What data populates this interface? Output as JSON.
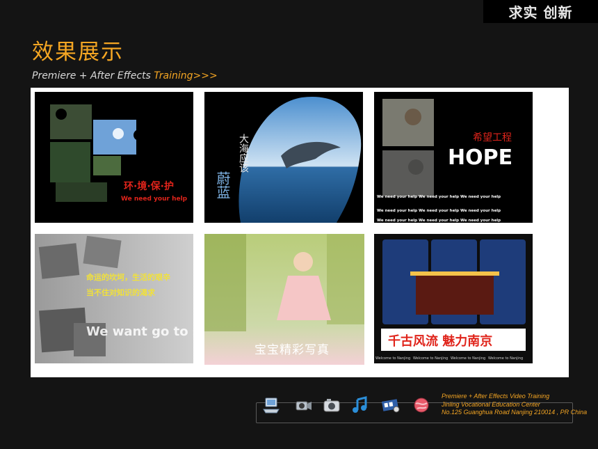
{
  "header": {
    "motto": "求实 创新",
    "title": "效果展示",
    "subtitle_prefix": "Premiere + After Effects ",
    "subtitle_highlight": "Training>>>"
  },
  "gallery": [
    {
      "id": "environment",
      "caption_cn": "环·境·保·护",
      "caption_en": "We need your help"
    },
    {
      "id": "dolphin",
      "caption_cn": "大海应该",
      "caption_cn2": "蔚蓝"
    },
    {
      "id": "hope",
      "caption_cn": "希望工程",
      "caption_en": "HOPE",
      "repeat_text": "We need your help"
    },
    {
      "id": "school",
      "caption_cn1": "命运的坎坷，生活的艰辛",
      "caption_cn2": "当不住对知识的渴求",
      "caption_en": "We want go to school"
    },
    {
      "id": "baby",
      "caption_cn": "宝宝精彩写真"
    },
    {
      "id": "nanjing",
      "caption_cn": "千古风流  魅力南京",
      "repeat_text": "Welcome to Nanjing"
    }
  ],
  "footer": {
    "line1": "Premiere + After Effects Video Training",
    "line2": "Jinling Vocational Education Center",
    "line3": "No.125 Guanghua Road Nanjing 210014 , PR China"
  },
  "dock_icons": [
    "computer-icon",
    "camcorder-icon",
    "camera-icon",
    "music-icon",
    "film-icon",
    "globe-icon"
  ],
  "colors": {
    "accent": "#f5a623",
    "background": "#141414",
    "panel": "#ffffff"
  }
}
